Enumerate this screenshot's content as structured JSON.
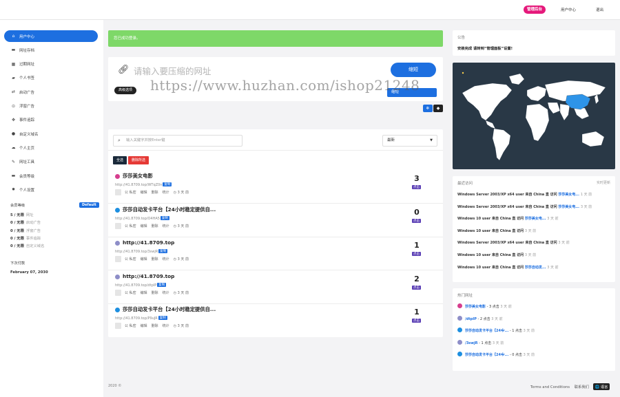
{
  "topbar": {
    "admin": "管理后台",
    "user_center": "用户中心",
    "logout": "退出"
  },
  "sidebar": {
    "items": [
      {
        "icon": "home-icon",
        "glyph": "⌂",
        "label": "用户中心"
      },
      {
        "icon": "briefcase-icon",
        "glyph": "▬",
        "label": "网址存档"
      },
      {
        "icon": "grid-icon",
        "glyph": "▦",
        "label": "过期网址"
      },
      {
        "icon": "folder-icon",
        "glyph": "▰",
        "label": "个人书签"
      },
      {
        "icon": "swap-icon",
        "glyph": "⇄",
        "label": "启动广告"
      },
      {
        "icon": "circle-icon",
        "glyph": "⊙",
        "label": "浮窗广告"
      },
      {
        "icon": "crosshair-icon",
        "glyph": "✥",
        "label": "事件追踪"
      },
      {
        "icon": "globe-icon",
        "glyph": "●",
        "label": "自定义域名"
      },
      {
        "icon": "cloud-icon",
        "glyph": "☁",
        "label": "个人主页"
      },
      {
        "icon": "wrench-icon",
        "glyph": "✎",
        "label": "网址工具"
      },
      {
        "icon": "card-icon",
        "glyph": "▬",
        "label": "会员等级"
      },
      {
        "icon": "gear-icon",
        "glyph": "✹",
        "label": "个人设置"
      }
    ],
    "membership": {
      "title": "会员等级",
      "badge": "Default",
      "lines": [
        {
          "bold": "5 / 无限",
          "light": "网址"
        },
        {
          "bold": "0 / 无限",
          "light": "启动广告"
        },
        {
          "bold": "0 / 无限",
          "light": "浮窗广告"
        },
        {
          "bold": "0 / 无限",
          "light": "事件追踪"
        },
        {
          "bold": "0 / 无限",
          "light": "自定义域名"
        }
      ],
      "next_payment_label": "下次付款",
      "next_payment_date": "February 07, 2030"
    }
  },
  "alert": {
    "text": "您已成功登录。"
  },
  "shorten": {
    "placeholder": "请输入要压缩的网址",
    "button": "缩短",
    "advanced": "高级选项",
    "button2": "缩短"
  },
  "watermark": "https://www.huzhan.com/ishop21248",
  "toggles": [
    "❄",
    "◆"
  ],
  "links": {
    "search_placeholder": "输入关键字并按Enter键",
    "sort": "最新",
    "select_all": "全选",
    "delete_selected": "删除所选",
    "rows": [
      {
        "favicon_color": "#d63e8e",
        "title": "莎莎美女电影",
        "short": "http://41.8709.top/WTqZ0n",
        "copy": "复制",
        "clicks": "3",
        "click_label": "点击",
        "actions": [
          "公 私密",
          "编辑",
          "删除",
          "统计",
          "◷ 3 天 前"
        ]
      },
      {
        "favicon_color": "#1d8fe0",
        "title": "莎莎自动发卡平台【24小时稳定提供自...",
        "short": "http://41.8709.top/O4HA5",
        "copy": "复制",
        "clicks": "0",
        "click_label": "点击",
        "actions": [
          "公 私密",
          "编辑",
          "删除",
          "统计",
          "◷ 3 天 前"
        ]
      },
      {
        "favicon_color": "#8e8ec8",
        "title": "http://41.8709.top",
        "short": "http://41.8709.top/3swjR",
        "copy": "复制",
        "clicks": "1",
        "click_label": "点击",
        "actions": [
          "公 私密",
          "编辑",
          "删除",
          "统计",
          "◷ 3 天 前"
        ]
      },
      {
        "favicon_color": "#8e8ec8",
        "title": "http://41.8709.top",
        "short": "http://41.8709.top/dtpIP",
        "copy": "复制",
        "clicks": "2",
        "click_label": "点击",
        "actions": [
          "公 私密",
          "编辑",
          "删除",
          "统计",
          "◷ 3 天 前"
        ]
      },
      {
        "favicon_color": "#1d8fe0",
        "title": "莎莎自动发卡平台【24小时稳定提供自...",
        "short": "http://41.8709.top/P9uJR",
        "copy": "复制",
        "clicks": "1",
        "click_label": "点击",
        "actions": [
          "公 私密",
          "编辑",
          "删除",
          "统计",
          "◷ 3 天 前"
        ]
      }
    ]
  },
  "notice": {
    "title": "公告",
    "text": "安装完成 请转到“管理面板”设置!"
  },
  "recent": {
    "title": "最近访问",
    "realtime": "实时更新",
    "rows": [
      {
        "text": "Windows Server 2003/XP x64 user 来自 China 直 访问 ",
        "link": "莎莎美女电...",
        "time": "1 天 前"
      },
      {
        "text": "Windows Server 2003/XP x64 user 来自 China 直 访问 ",
        "link": "莎莎美女电...",
        "time": "3 天 前"
      },
      {
        "text": "Windows 10 user 来自 China 直 访问 ",
        "link": "莎莎美女电...",
        "time": "3 天 前"
      },
      {
        "text": "Windows 10 user 来自 China 直 访问 ",
        "link": "",
        "time": "3 天 前"
      },
      {
        "text": "Windows Server 2003/XP x64 user 来自 China 直 访问 ",
        "link": "",
        "time": "3 天 前"
      },
      {
        "text": "Windows 10 user 来自 China 直 访问 ",
        "link": "",
        "time": "3 天 前"
      },
      {
        "text": "Windows 10 user 来自 China 直 访问 ",
        "link": "莎莎自动发...",
        "time": "3 天 前"
      }
    ]
  },
  "popular": {
    "title": "热门网址",
    "rows": [
      {
        "color": "#d63e8e",
        "link": "莎莎美女电影",
        "count": " - 3 点击",
        "time": "3 天 前"
      },
      {
        "color": "#8e8ec8",
        "link": "/dtpIP",
        "count": " - 2 点击",
        "time": "3 天 前"
      },
      {
        "color": "#1d8fe0",
        "link": "莎莎自动发卡平台【24�...",
        "count": " - 1 点击",
        "time": "3 天 前"
      },
      {
        "color": "#8e8ec8",
        "link": "/3swjR",
        "count": " - 1 点击",
        "time": "3 天 前"
      },
      {
        "color": "#1d8fe0",
        "link": "莎莎自动发卡平台【24�...",
        "count": " - 0 点击",
        "time": "3 天 前"
      }
    ]
  },
  "footer": {
    "copyright": "2020 ©",
    "terms": "Terms and Conditions",
    "contact": "联系我们",
    "lang": "🌐 语言"
  }
}
